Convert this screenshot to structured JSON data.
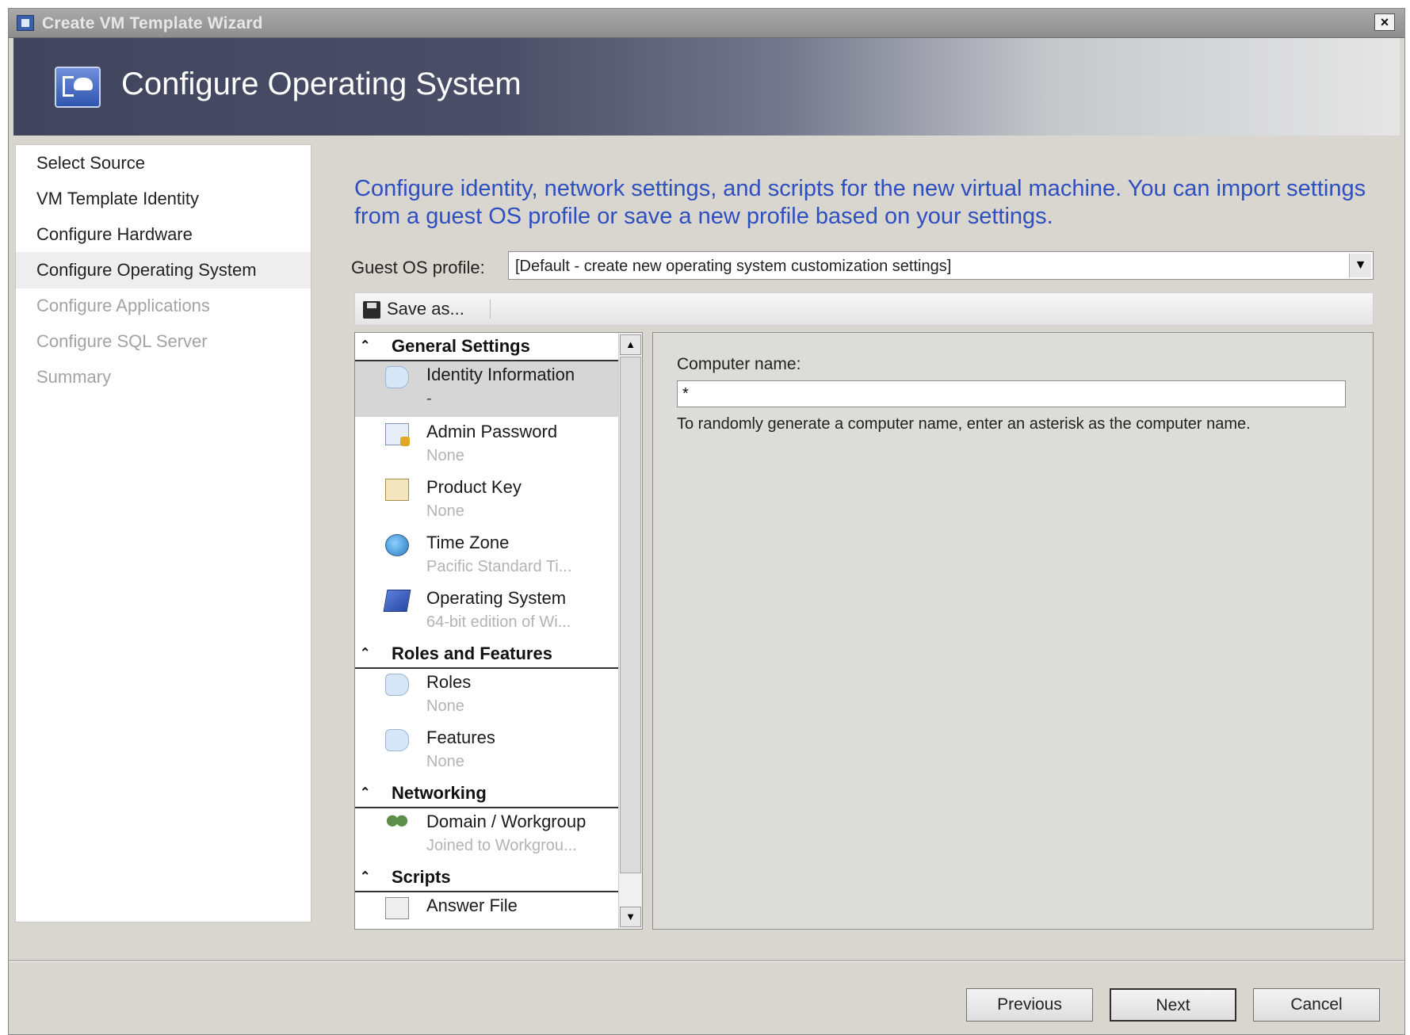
{
  "window": {
    "title": "Create VM Template Wizard",
    "close_glyph": "×"
  },
  "banner": {
    "title": "Configure Operating System"
  },
  "nav": {
    "items": [
      {
        "label": "Select Source",
        "state": "done"
      },
      {
        "label": "VM Template Identity",
        "state": "done"
      },
      {
        "label": "Configure Hardware",
        "state": "done"
      },
      {
        "label": "Configure Operating System",
        "state": "current"
      },
      {
        "label": "Configure Applications",
        "state": "disabled"
      },
      {
        "label": "Configure SQL Server",
        "state": "disabled"
      },
      {
        "label": "Summary",
        "state": "disabled"
      }
    ]
  },
  "main": {
    "intro": "Configure identity, network settings, and scripts for the new virtual machine. You can import settings from a guest OS profile or save a new profile based on your settings.",
    "profile_label": "Guest OS profile:",
    "profile_value": "[Default - create new operating system customization settings]",
    "save_as_label": "Save as..."
  },
  "tree": {
    "sections": [
      {
        "title": "General Settings",
        "items": [
          {
            "name": "Identity Information",
            "sub": "-",
            "icon": "tag-icon",
            "selected": true
          },
          {
            "name": "Admin Password",
            "sub": "None",
            "icon": "password-icon"
          },
          {
            "name": "Product Key",
            "sub": "None",
            "icon": "product-key-icon"
          },
          {
            "name": "Time Zone",
            "sub": "Pacific Standard Ti...",
            "icon": "globe-icon"
          },
          {
            "name": "Operating System",
            "sub": "64-bit edition of Wi...",
            "icon": "os-icon"
          }
        ]
      },
      {
        "title": "Roles and Features",
        "items": [
          {
            "name": "Roles",
            "sub": "None",
            "icon": "tag-icon"
          },
          {
            "name": "Features",
            "sub": "None",
            "icon": "tag-icon"
          }
        ]
      },
      {
        "title": "Networking",
        "items": [
          {
            "name": "Domain / Workgroup",
            "sub": "Joined to Workgrou...",
            "icon": "domain-icon"
          }
        ]
      },
      {
        "title": "Scripts",
        "items": [
          {
            "name": "Answer File",
            "sub": "",
            "icon": "answer-file-icon"
          }
        ]
      }
    ]
  },
  "details": {
    "computer_name_label": "Computer name:",
    "computer_name_value": "*",
    "hint": "To randomly generate a computer name, enter an asterisk as the computer name."
  },
  "footer": {
    "previous": "Previous",
    "next": "Next",
    "cancel": "Cancel"
  },
  "colors": {
    "intro_text": "#2e4fbf",
    "dialog_bg": "#d8d6cf",
    "banner_dark": "#40445c"
  }
}
